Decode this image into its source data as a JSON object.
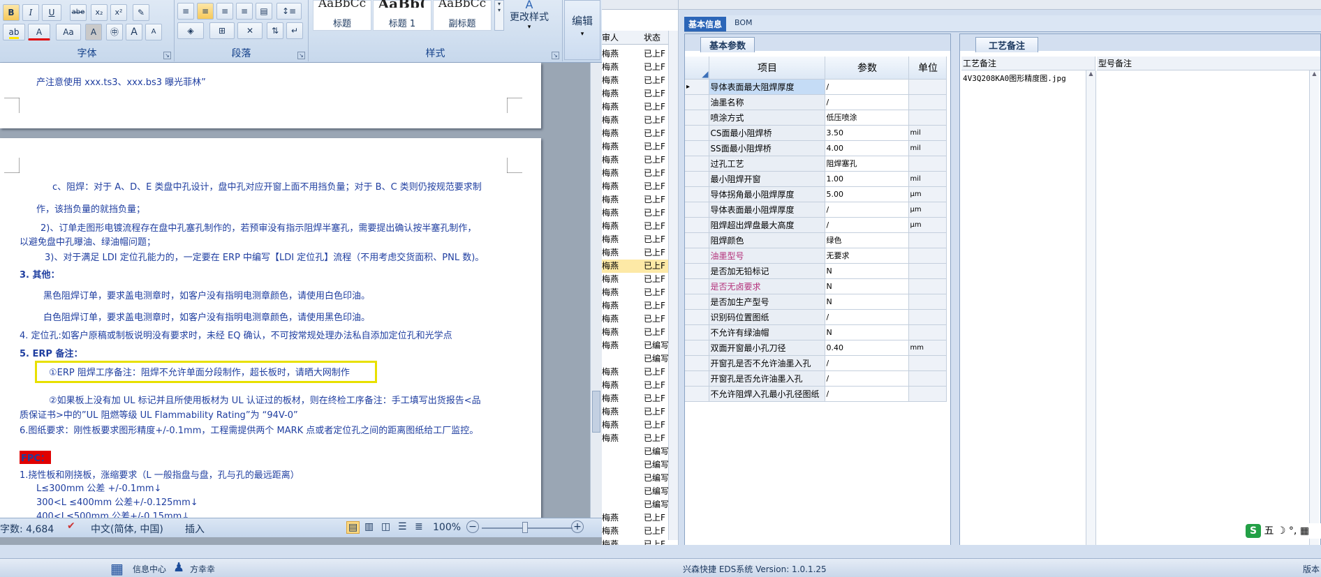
{
  "ribbon": {
    "font_group_label": "字体",
    "para_group_label": "段落",
    "styles_group_label": "样式",
    "style_items": [
      {
        "preview": "AaBbCc",
        "label": "标题"
      },
      {
        "preview": "AaBb(",
        "label": "标题 1"
      },
      {
        "preview": "AaBbCc",
        "label": "副标题"
      }
    ],
    "change_style_label": "更改样式",
    "edit_label": "编辑",
    "bold": "B",
    "italic": "I",
    "underline": "U",
    "strike": "abe",
    "sub": "x₂",
    "sup": "x²",
    "font_color": "A",
    "case": "Aa",
    "char_shade": "A",
    "enlarge": "A",
    "shrink": "A"
  },
  "document": {
    "line_top": "产注意使用 xxx.ts3、xxx.bs3 曝光菲林”",
    "lines": [
      "c、阻焊：对于 A、D、E 类盘中孔设计，盘中孔对应开窗上面不用挡负量；对于 B、C 类则仍按规范要求制",
      "作，该挡负量的就挡负量；",
      "2)、订单走图形电镀流程存在盘中孔塞孔制作的，若预审没有指示阻焊半塞孔，需要提出确认按半塞孔制作，",
      "以避免盘中孔曝油、绿油帽问题；",
      "3)、对于满足 LDI 定位孔能力的，一定要在 ERP 中编写【LDI 定位孔】流程（不用考虑交货面积、PNL 数)。",
      "3. 其他：",
      "黑色阻焊订单，要求盖电测章时，如客户没有指明电测章颜色，请使用白色印油。",
      "白色阻焊订单，要求盖电测章时，如客户没有指明电测章颜色，请使用黑色印油。",
      "4. 定位孔:如客户原稿或制板说明没有要求时，未经 EQ 确认，不可按常规处理办法私自添加定位孔和光学点",
      "5. ERP 备注：",
      "①ERP 阻焊工序备注：阻焊不允许单面分段制作，超长板时，请晒大网制作",
      "②如果板上没有加 UL 标记并且所使用板材为 UL 认证过的板材，则在终检工序备注：手工填写出货报告<品",
      "质保证书>中的”UL 阻燃等级 UL Flammability Rating”为 “94V-0”",
      "6.图纸要求：刚性板要求图形精度+/-0.1mm，工程需提供两个 MARK 点或者定位孔之间的距离图纸给工厂监控。",
      "FPC：",
      "1.挠性板和刚挠板，涨缩要求（L 一般指盘与盘，孔与孔的最远距离）",
      "L≤300mm 公差 +/-0.1mm↓",
      "300<L ≤400mm 公差+/-0.125mm↓",
      "400<L≤500mm 公差+/-0.15mm↓"
    ]
  },
  "statusbar": {
    "wordcount": "字数: 4,684",
    "language": "中文(简体, 中国)",
    "mode": "插入",
    "zoom": "100%"
  },
  "midlist": {
    "header_person": "审人",
    "header_status": "状态",
    "rows": [
      {
        "p": "梅燕",
        "s": "已上F"
      },
      {
        "p": "梅燕",
        "s": "已上F"
      },
      {
        "p": "梅燕",
        "s": "已上F"
      },
      {
        "p": "梅燕",
        "s": "已上F"
      },
      {
        "p": "梅燕",
        "s": "已上F"
      },
      {
        "p": "梅燕",
        "s": "已上F"
      },
      {
        "p": "梅燕",
        "s": "已上F"
      },
      {
        "p": "梅燕",
        "s": "已上F"
      },
      {
        "p": "梅燕",
        "s": "已上F"
      },
      {
        "p": "梅燕",
        "s": "已上F"
      },
      {
        "p": "梅燕",
        "s": "已上F"
      },
      {
        "p": "梅燕",
        "s": "已上F"
      },
      {
        "p": "梅燕",
        "s": "已上F"
      },
      {
        "p": "梅燕",
        "s": "已上F"
      },
      {
        "p": "梅燕",
        "s": "已上F"
      },
      {
        "p": "梅燕",
        "s": "已上F"
      },
      {
        "p": "梅燕",
        "s": "已上F"
      },
      {
        "p": "梅燕",
        "s": "已上F"
      },
      {
        "p": "梅燕",
        "s": "已上F"
      },
      {
        "p": "梅燕",
        "s": "已上F"
      },
      {
        "p": "梅燕",
        "s": "已上F"
      },
      {
        "p": "梅燕",
        "s": "已上F"
      },
      {
        "p": "梅燕",
        "s": "已编写"
      },
      {
        "p": "",
        "s": "已编写"
      },
      {
        "p": "梅燕",
        "s": "已上F"
      },
      {
        "p": "梅燕",
        "s": "已上F"
      },
      {
        "p": "梅燕",
        "s": "已上F"
      },
      {
        "p": "梅燕",
        "s": "已上F"
      },
      {
        "p": "梅燕",
        "s": "已上F"
      },
      {
        "p": "梅燕",
        "s": "已上F"
      },
      {
        "p": "",
        "s": "已编写"
      },
      {
        "p": "",
        "s": "已编写"
      },
      {
        "p": "",
        "s": "已编写"
      },
      {
        "p": "",
        "s": "已编写"
      },
      {
        "p": "",
        "s": "已编写"
      },
      {
        "p": "梅燕",
        "s": "已上F"
      },
      {
        "p": "梅燕",
        "s": "已上F"
      },
      {
        "p": "梅燕",
        "s": "已上F"
      },
      {
        "p": "梅燕",
        "s": "已上F"
      },
      {
        "p": "梅燕",
        "s": "已上F"
      }
    ]
  },
  "right": {
    "tab_basic": "基本信息",
    "tab_bom": "BOM",
    "subtab_params": "基本参数",
    "subtab_process": "工艺备注",
    "col_item": "项目",
    "col_param": "参数",
    "col_unit": "单位",
    "col_proc_note": "工艺备注",
    "col_model_note": "型号备注",
    "proc_note_value": "4V3Q208KA0图形精度图.jpg",
    "rows": [
      {
        "item": "导体表面最大阻焊厚度",
        "param": "/",
        "unit": ""
      },
      {
        "item": "油墨名称",
        "param": "/",
        "unit": ""
      },
      {
        "item": "喷涂方式",
        "param": "低压喷涂",
        "unit": ""
      },
      {
        "item": "CS面最小阻焊桥",
        "param": "3.50",
        "unit": "mil"
      },
      {
        "item": "SS面最小阻焊桥",
        "param": "4.00",
        "unit": "mil"
      },
      {
        "item": "过孔工艺",
        "param": "阻焊塞孔",
        "unit": ""
      },
      {
        "item": "最小阻焊开窗",
        "param": "1.00",
        "unit": "mil"
      },
      {
        "item": "导体拐角最小阻焊厚度",
        "param": "5.00",
        "unit": "μm"
      },
      {
        "item": "导体表面最小阻焊厚度",
        "param": "/",
        "unit": "μm"
      },
      {
        "item": "阻焊超出焊盘最大高度",
        "param": "/",
        "unit": "μm"
      },
      {
        "item": "阻焊颜色",
        "param": "绿色",
        "unit": ""
      },
      {
        "item": "油墨型号",
        "param": "无要求",
        "unit": ""
      },
      {
        "item": "是否加无铅标记",
        "param": "N",
        "unit": ""
      },
      {
        "item": "是否无卤要求",
        "param": "N",
        "unit": ""
      },
      {
        "item": "是否加生产型号",
        "param": "N",
        "unit": ""
      },
      {
        "item": "识别码位置图纸",
        "param": "/",
        "unit": ""
      },
      {
        "item": "不允许有绿油帽",
        "param": "N",
        "unit": ""
      },
      {
        "item": "双面开窗最小孔刀径",
        "param": "0.40",
        "unit": "mm"
      },
      {
        "item": "开窗孔是否不允许油墨入孔",
        "param": "/",
        "unit": ""
      },
      {
        "item": "开窗孔是否允许油墨入孔",
        "param": "/",
        "unit": ""
      },
      {
        "item": "不允许阻焊入孔最小孔径图纸",
        "param": "/",
        "unit": ""
      }
    ],
    "version": "兴森快捷 EDS系统 Version: 1.0.1.25"
  },
  "taskbar": {
    "info_center": "信息中心",
    "user": "方幸幸",
    "ime": "五",
    "right_label": "版本"
  },
  "colors": {
    "accent": "#1f3ea0",
    "highlight_box": "#e8e000",
    "fpc_bg": "#e00000",
    "selected_row": "#c5dcf6",
    "pink_text": "#b4307a"
  }
}
